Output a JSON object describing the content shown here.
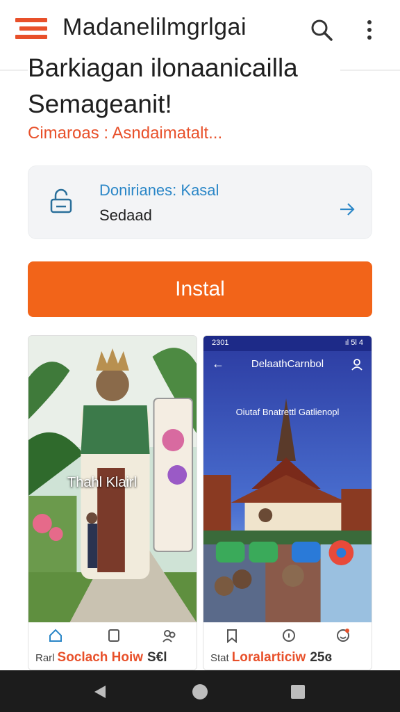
{
  "app_bar": {
    "title": "Madanelilmgrlgai",
    "icons": [
      "menu-logo-icon",
      "search-icon",
      "more-vert-icon"
    ]
  },
  "headline": "Barkiagan ilonaanicailla Semageanit!",
  "subtitle": "Cimaroas : Asndaimatalt...",
  "info_card": {
    "label": "Donirianes: Kasal",
    "value": "Sedaad",
    "icons": [
      "lock-icon",
      "arrow-right-icon"
    ]
  },
  "install_button": {
    "label": "Instal"
  },
  "screenshots": [
    {
      "overlay_text": "Thahl Klairl",
      "caption": {
        "muted": "Rarl",
        "accent": "Soclach Hoiw",
        "tail": "S€l"
      },
      "nav_icons": [
        "home-icon",
        "square-icon",
        "people-icon"
      ]
    },
    {
      "status_left": "2301",
      "status_right": "ıl 5l 4",
      "header_title": "DelaathCarnbol",
      "banner": "Oiutaf Bnatrettl Gatlienopl",
      "caption": {
        "muted": "Stat",
        "accent": "Loralarticiw",
        "tail": "25ɞ"
      },
      "nav_icons": [
        "bookmark-icon",
        "info-icon",
        "face-icon"
      ]
    }
  ],
  "colors": {
    "accent": "#f26419",
    "brand_orange": "#e8502a",
    "link_blue": "#2a86c7",
    "card_bg": "#f3f4f6",
    "system_bar": "#1c1c1c"
  }
}
